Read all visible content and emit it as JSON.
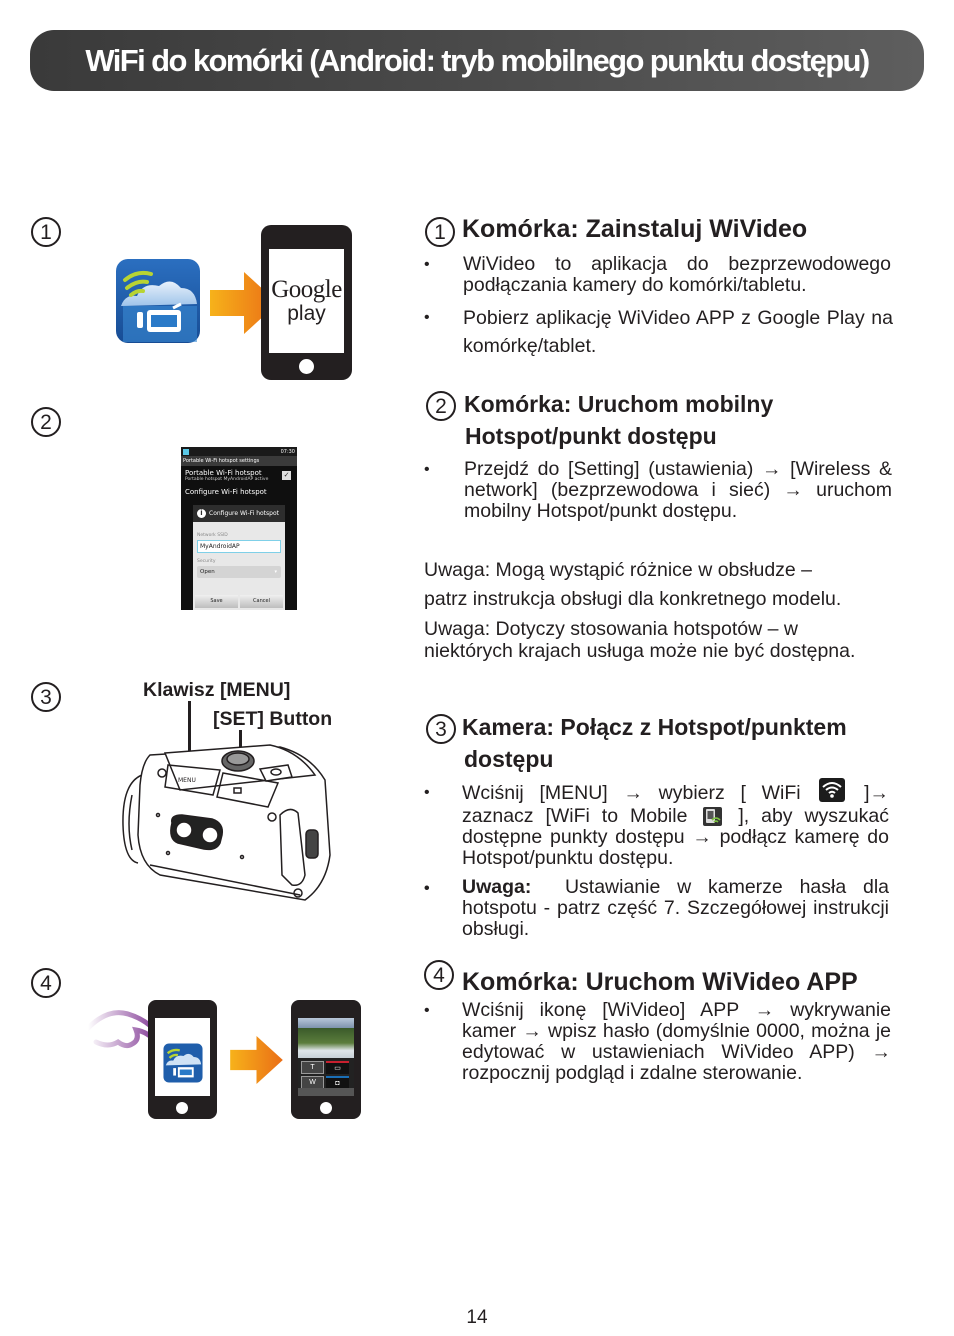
{
  "title": "WiFi do komórki (Android: tryb mobilnego punktu dostępu)",
  "colors": {
    "title_bar": "#4a4a4a",
    "arrow_orange": "#f08c1a",
    "app_icon_blue": "#1a5fae",
    "text": "#231f20"
  },
  "steps": [
    {
      "number": "1",
      "heading": "Komórka: Zainstaluj WiVideo",
      "bullets": [
        "WiVideo to aplikacja do bezprzewodowego podłączania kamery do komórki/tabletu.",
        "Pobierz aplikację WiVideo APP z Google Play na komórkę/tablet."
      ],
      "illustration": {
        "app_icon": "wivideo-app-icon",
        "arrow": "arrow-right-icon",
        "phone_text_line1": "Google",
        "phone_text_line2": "play"
      }
    },
    {
      "number": "2",
      "heading_line1": "Komórka: Uruchom mobilny",
      "heading_line2": "Hotspot/punkt dostępu",
      "bullets": [
        "Przejdź do [Setting] (ustawienia) → [Wireless & network] (bezprzewodowa i sieć) → uruchom mobilny Hotspot/punkt dostępu."
      ],
      "notes": [
        "Uwaga: Mogą wystąpić różnice w obsłudze –",
        "patrz instrukcja obsługi dla konkretnego modelu.",
        "Uwaga: Dotyczy stosowania hotspotów – w",
        "niektórych krajach usługa może nie być dostępna."
      ],
      "screenshot": {
        "status_time": "07:30",
        "header": "Portable Wi-Fi hotspot settings",
        "item1_title": "Portable Wi-Fi hotspot",
        "item1_sub": "Portable hotspot MyAndroidAP active",
        "item2_title": "Configure Wi-Fi hotspot",
        "dialog_title": "Configure Wi-Fi hotspot",
        "ssid_label": "Network SSID",
        "ssid_value": "MyAndroidAP",
        "security_label": "Security",
        "security_value": "Open",
        "save": "Save",
        "cancel": "Cancel"
      }
    },
    {
      "number": "3",
      "heading_line1": "Kamera: Połącz z Hotspot/punktem",
      "heading_line2": "dostępu",
      "callout_menu": "Klawisz [MENU]",
      "callout_set": "[SET] Button",
      "camera_menu_label": "MENU",
      "bullet1_part1": "Wciśnij [MENU] → wybierz [ WiFi",
      "bullet1_part2": "]→ zaznacz [WiFi to Mobile",
      "bullet1_part3": "], aby wyszukać dostępne punkty dostępu → podłącz kamerę do Hotspot/punktu dostępu.",
      "bullet2_bold": "Uwaga:",
      "bullet2_text": "Ustawianie w kamerze hasła dla hotspotu - patrz część 7. Szczegółowej instrukcji obsługi."
    },
    {
      "number": "4",
      "heading": "Komórka: Uruchom WiVideo APP",
      "bullets": [
        "Wciśnij ikonę [WiVideo] APP → wykrywanie kamer → wpisz hasło (domyślnie 0000, można je edytować w ustawieniach WiVideo APP) → rozpocznij podgląd i zdalne sterowanie."
      ],
      "app_screen": {
        "btn_t": "T",
        "btn_w": "W"
      }
    }
  ],
  "bullet_char": "•",
  "page_number": "14"
}
